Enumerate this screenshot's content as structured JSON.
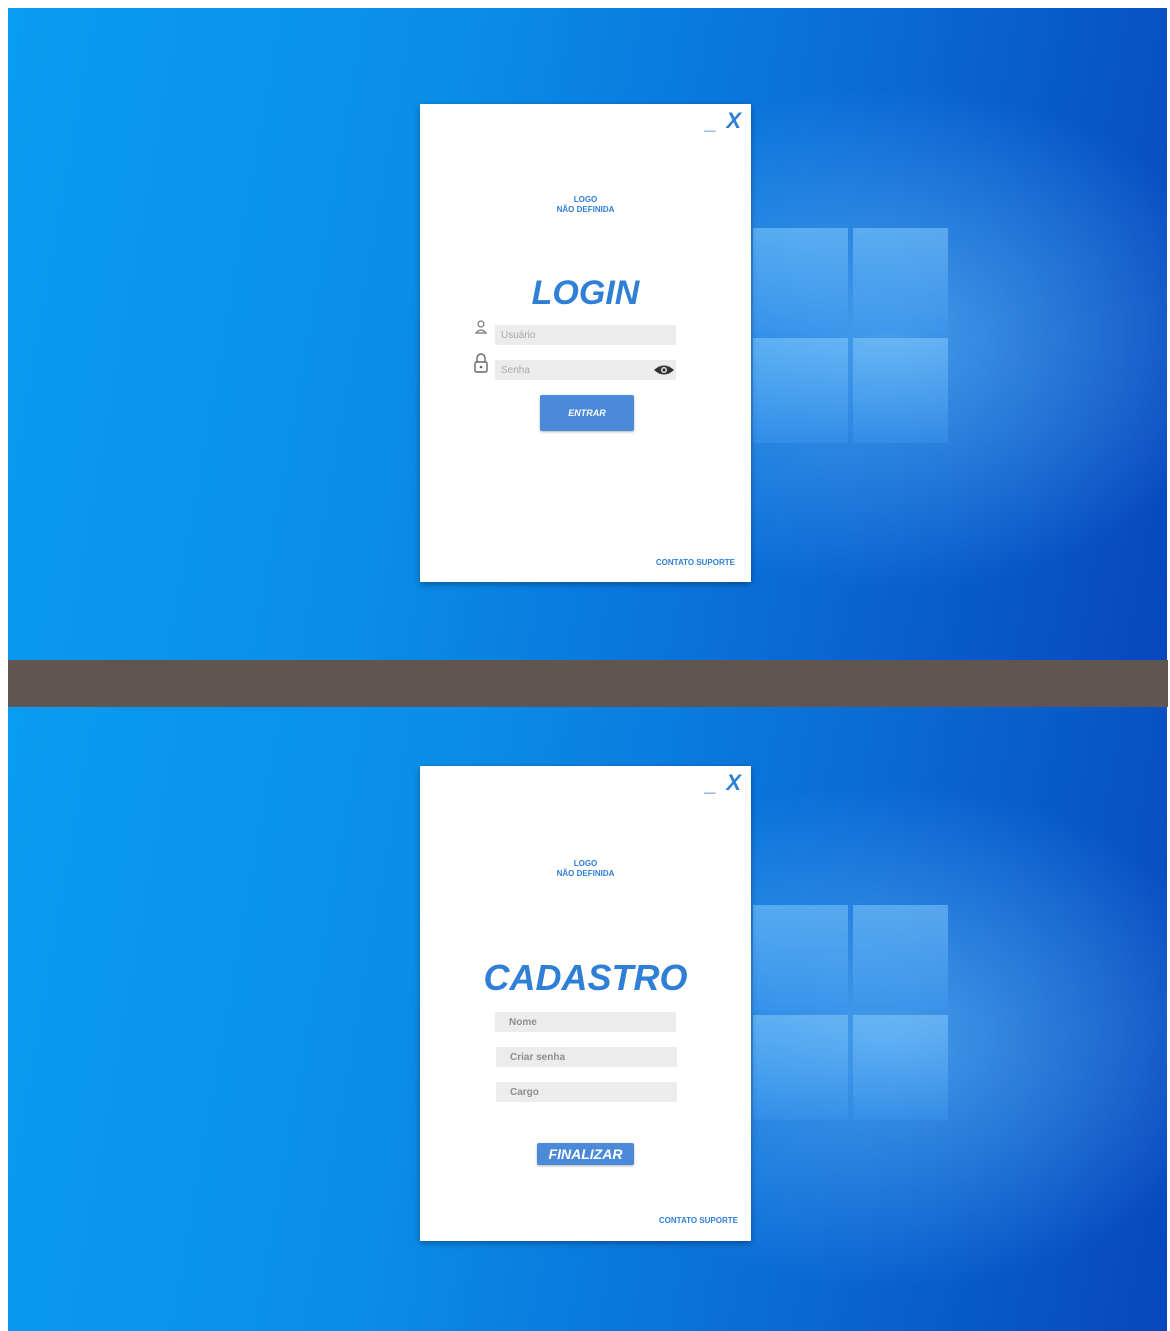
{
  "login_window": {
    "minimize_label": "_",
    "close_label": "X",
    "logo_line1": "LOGO",
    "logo_line2": "NÃO DEFINIDA",
    "title": "LOGIN",
    "username_placeholder": "Usuário",
    "password_placeholder": "Senha",
    "submit_label": "ENTRAR",
    "support_link": "CONTATO SUPORTE",
    "icons": [
      "user-icon",
      "lock-icon",
      "eye-icon"
    ]
  },
  "register_window": {
    "minimize_label": "_",
    "close_label": "X",
    "logo_line1": "LOGO",
    "logo_line2": "NÃO DEFINIDA",
    "title": "CADASTRO",
    "name_placeholder": "Nome",
    "password_placeholder": "Criar senha",
    "role_placeholder": "Cargo",
    "submit_label": "FINALIZAR",
    "support_link": "CONTATO SUPORTE"
  },
  "colors": {
    "accent": "#2f7fd6",
    "button": "#4a8ad8",
    "field_bg": "#ececec",
    "separator": "#5f5551",
    "desktop_blue": "#0a8ee8"
  }
}
